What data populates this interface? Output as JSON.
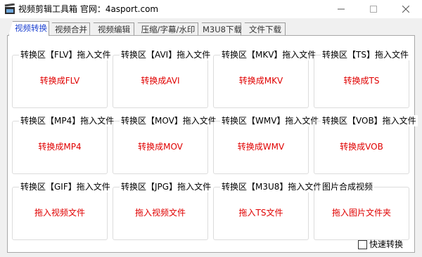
{
  "window": {
    "title": "视频剪辑工具箱 官网：4asport.com",
    "controls": [
      "minimize",
      "maximize",
      "close"
    ]
  },
  "tabs": [
    {
      "label": "视频转换",
      "active": true
    },
    {
      "label": "视频合并",
      "active": false
    },
    {
      "label": "视频编辑",
      "active": false
    },
    {
      "label": "压缩/字幕/水印",
      "active": false
    },
    {
      "label": "M3U8下载",
      "active": false
    },
    {
      "label": "文件下载",
      "active": false
    }
  ],
  "groups": [
    {
      "label": "转换区【FLV】拖入文件",
      "action": "转换成FLV"
    },
    {
      "label": "转换区【AVI】拖入文件",
      "action": "转换成AVI"
    },
    {
      "label": "转换区【MKV】拖入文件",
      "action": "转换成MKV"
    },
    {
      "label": "转换区【TS】拖入文件",
      "action": "转换成TS"
    },
    {
      "label": "转换区【MP4】拖入文件",
      "action": "转换成MP4"
    },
    {
      "label": "转换区【MOV】拖入文件",
      "action": "转换成MOV"
    },
    {
      "label": "转换区【WMV】拖入文件",
      "action": "转换成WMV"
    },
    {
      "label": "转换区【VOB】拖入文件",
      "action": "转换成VOB"
    },
    {
      "label": "转换区【GIF】拖入文件",
      "action": "拖入视频文件"
    },
    {
      "label": "转换区【JPG】拖入文件",
      "action": "拖入视频文件"
    },
    {
      "label": "转换区【M3U8】拖入文件",
      "action": "拖入TS文件"
    },
    {
      "label": "图片合成视频",
      "action": "拖入图片文件夹"
    }
  ],
  "quick_convert": {
    "label": "快速转换",
    "checked": false
  },
  "colors": {
    "action_text": "#e00000",
    "active_tab_text": "#1a3fd0"
  }
}
